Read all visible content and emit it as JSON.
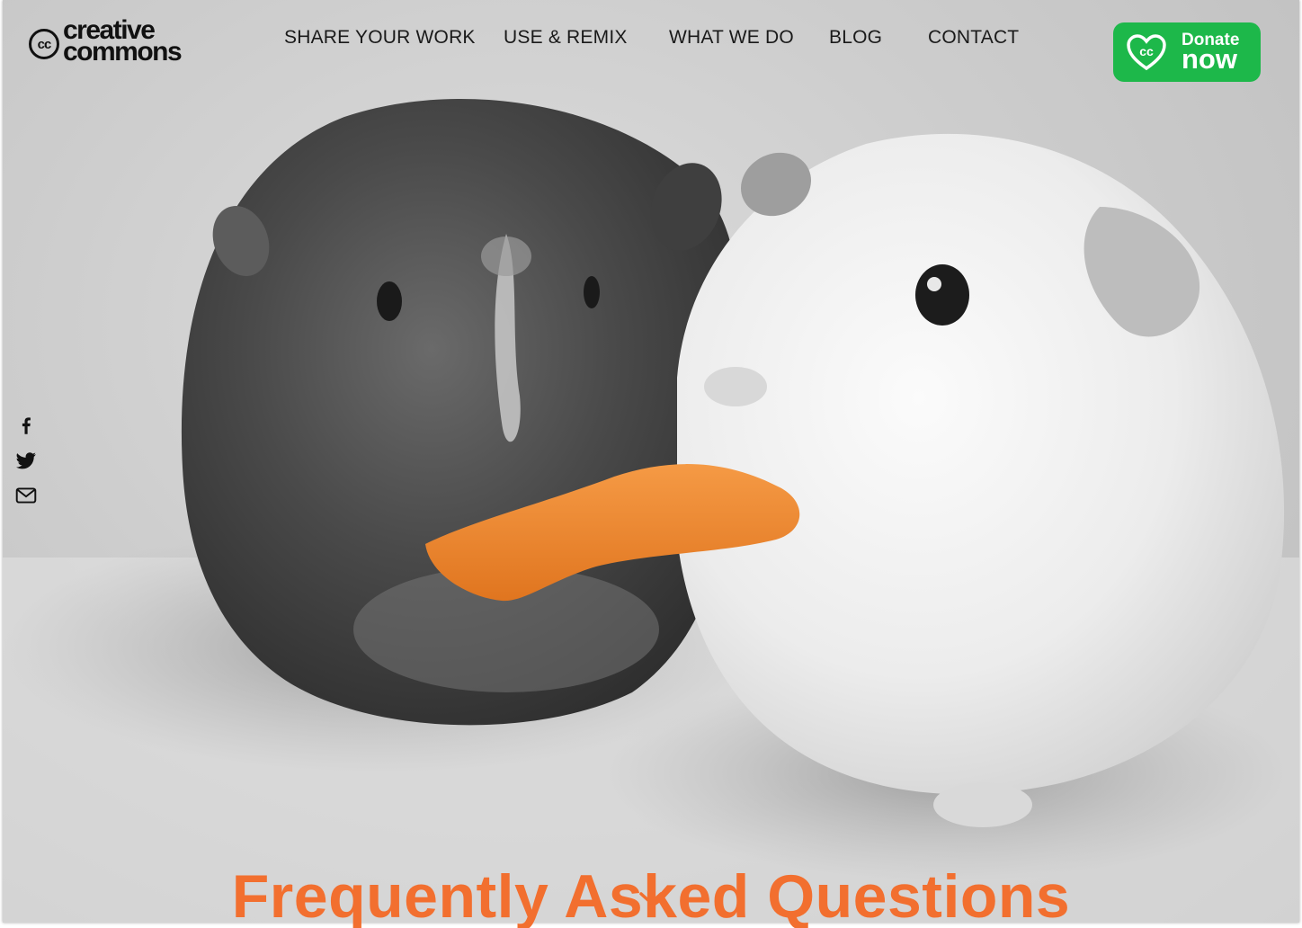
{
  "logo": {
    "mark": "cc",
    "line1": "creative",
    "line2": "commons"
  },
  "nav": {
    "items": [
      {
        "label": "SHARE YOUR WORK"
      },
      {
        "label": "USE & REMIX"
      },
      {
        "label": "WHAT WE DO"
      },
      {
        "label": "BLOG"
      },
      {
        "label": "CONTACT"
      }
    ]
  },
  "donate": {
    "line1": "Donate",
    "line2": "now",
    "color": "#1db84a"
  },
  "social": {
    "icons": [
      "facebook-icon",
      "twitter-icon",
      "mail-icon"
    ]
  },
  "hero": {
    "title": "Frequently Asked Questions",
    "title_color": "#f26f2f",
    "scroll_icon": "chevron-down-icon"
  }
}
